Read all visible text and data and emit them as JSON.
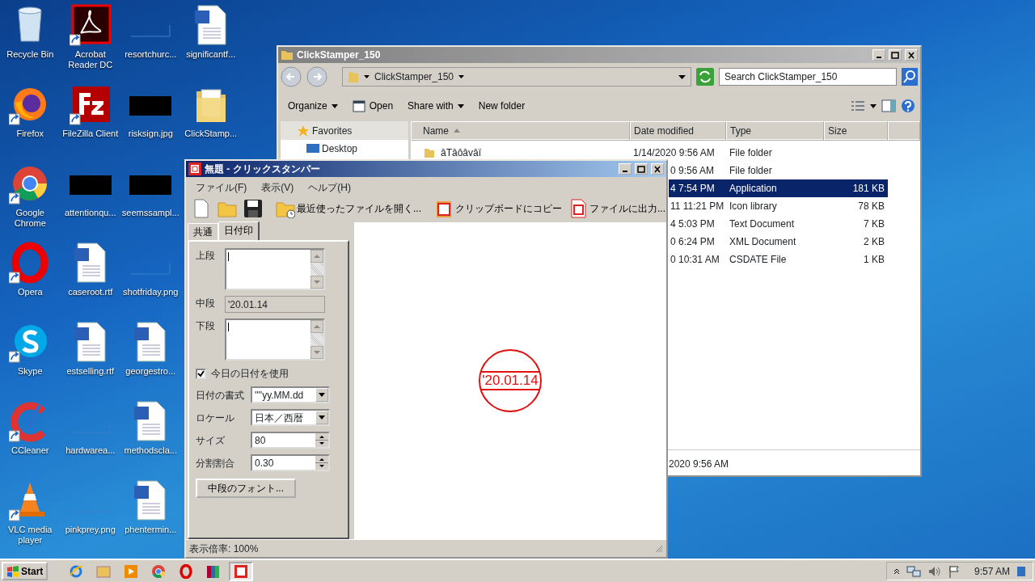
{
  "desktop": {
    "icons": [
      {
        "label": "Recycle Bin",
        "kind": "recycle",
        "shortcut": false
      },
      {
        "label": "Firefox",
        "kind": "firefox",
        "shortcut": true
      },
      {
        "label": "Google Chrome",
        "kind": "chrome",
        "shortcut": true
      },
      {
        "label": "Opera",
        "kind": "opera",
        "shortcut": true
      },
      {
        "label": "Skype",
        "kind": "skype",
        "shortcut": true
      },
      {
        "label": "CCleaner",
        "kind": "ccleaner",
        "shortcut": true
      },
      {
        "label": "VLC media player",
        "kind": "vlc",
        "shortcut": true
      },
      {
        "label": "Acrobat Reader DC",
        "kind": "acrobat",
        "shortcut": true
      },
      {
        "label": "FileZilla Client",
        "kind": "filezilla",
        "shortcut": true
      },
      {
        "label": "attentionqu...",
        "kind": "thumbnail",
        "shortcut": false
      },
      {
        "label": "caseroot.rtf",
        "kind": "document",
        "shortcut": false
      },
      {
        "label": "estselling.rtf",
        "kind": "document",
        "shortcut": false
      },
      {
        "label": "hardwarea...",
        "kind": "blank",
        "shortcut": false
      },
      {
        "label": "pinkprey.png",
        "kind": "blank",
        "shortcut": false
      },
      {
        "label": "resortchurc...",
        "kind": "blank",
        "shortcut": false
      },
      {
        "label": "risksign.jpg",
        "kind": "thumbnail",
        "shortcut": false
      },
      {
        "label": "seemssampl...",
        "kind": "thumbnail",
        "shortcut": false
      },
      {
        "label": "shotfriday.png",
        "kind": "blank",
        "shortcut": false
      },
      {
        "label": "georgestro...",
        "kind": "document",
        "shortcut": false
      },
      {
        "label": "methodscla...",
        "kind": "document",
        "shortcut": false
      },
      {
        "label": "phentermin...",
        "kind": "document",
        "shortcut": false
      },
      {
        "label": "significantf...",
        "kind": "document",
        "shortcut": false
      },
      {
        "label": "ClickStamp...",
        "kind": "folder",
        "shortcut": false
      }
    ]
  },
  "explorer": {
    "title": "ClickStamper_150",
    "address": "ClickStamper_150",
    "search": {
      "placeholder": "Search ClickStamper_150"
    },
    "toolbar": [
      {
        "label": "Organize",
        "kind": "menu"
      },
      {
        "label": "Open",
        "kind": "open"
      },
      {
        "label": "Share with",
        "kind": "menu"
      },
      {
        "label": "New folder",
        "kind": "plain"
      }
    ],
    "nav": [
      {
        "label": "Favorites",
        "kind": "group"
      },
      {
        "label": "Desktop",
        "kind": "item"
      }
    ],
    "columns": [
      "Name",
      "Date modified",
      "Type",
      "Size"
    ],
    "rows": [
      {
        "name": "âTâôâvâï",
        "date": "1/14/2020 9:56 AM",
        "type": "File folder",
        "size": "",
        "selected": false
      },
      {
        "date": "0 9:56 AM",
        "type": "File folder",
        "size": "",
        "selected": false
      },
      {
        "date": "4 7:54 PM",
        "type": "Application",
        "size": "181 KB",
        "selected": true
      },
      {
        "date": "11 11:21 PM",
        "type": "Icon library",
        "size": "78 KB",
        "selected": false
      },
      {
        "date": "4 5:03 PM",
        "type": "Text Document",
        "size": "7 KB",
        "selected": false
      },
      {
        "date": "0 6:24 PM",
        "type": "XML Document",
        "size": "2 KB",
        "selected": false
      },
      {
        "date": "0 10:31 AM",
        "type": "CSDATE File",
        "size": "1 KB",
        "selected": false
      }
    ],
    "details": "2020 9:56 AM"
  },
  "app": {
    "title": "無題 - クリックスタンパー",
    "menu": [
      "ファイル(F)",
      "表示(V)",
      "ヘルプ(H)"
    ],
    "toolbar": [
      {
        "kind": "new"
      },
      {
        "kind": "open"
      },
      {
        "kind": "save"
      },
      {
        "kind": "recent",
        "label": "最近使ったファイルを開く..."
      },
      {
        "kind": "copy",
        "label": "クリップボードにコピー"
      },
      {
        "kind": "export",
        "label": "ファイルに出力..."
      }
    ],
    "tabs": [
      {
        "label": "共通",
        "selected": false
      },
      {
        "label": "日付印",
        "selected": true
      }
    ],
    "form": [
      {
        "kind": "textarea",
        "label": "上段"
      },
      {
        "kind": "readonly",
        "label": "中段",
        "value": "'20.01.14"
      },
      {
        "kind": "textarea",
        "label": "下段"
      },
      {
        "kind": "checkbox",
        "label": "今日の日付を使用",
        "checked": true
      },
      {
        "kind": "select",
        "label": "日付の書式",
        "value": "''''yy.MM.dd"
      },
      {
        "kind": "select",
        "label": "ロケール",
        "value": "日本／西暦"
      },
      {
        "kind": "spin",
        "label": "サイズ",
        "value": "80"
      },
      {
        "kind": "spin",
        "label": "分割割合",
        "value": "0.30"
      },
      {
        "kind": "button",
        "label": "中段のフォント..."
      }
    ],
    "stamp": {
      "text": "'20.01.14"
    },
    "status": "表示倍率: 100%"
  },
  "taskbar": {
    "start": "Start",
    "apps": [
      {
        "kind": "ie",
        "selected": false
      },
      {
        "kind": "explorer",
        "selected": false
      },
      {
        "kind": "media",
        "selected": false
      },
      {
        "kind": "chrome",
        "selected": false
      },
      {
        "kind": "opera",
        "selected": false
      },
      {
        "kind": "winrar",
        "selected": false
      },
      {
        "kind": "stamper",
        "selected": true
      }
    ],
    "clock": "9:57 AM"
  }
}
